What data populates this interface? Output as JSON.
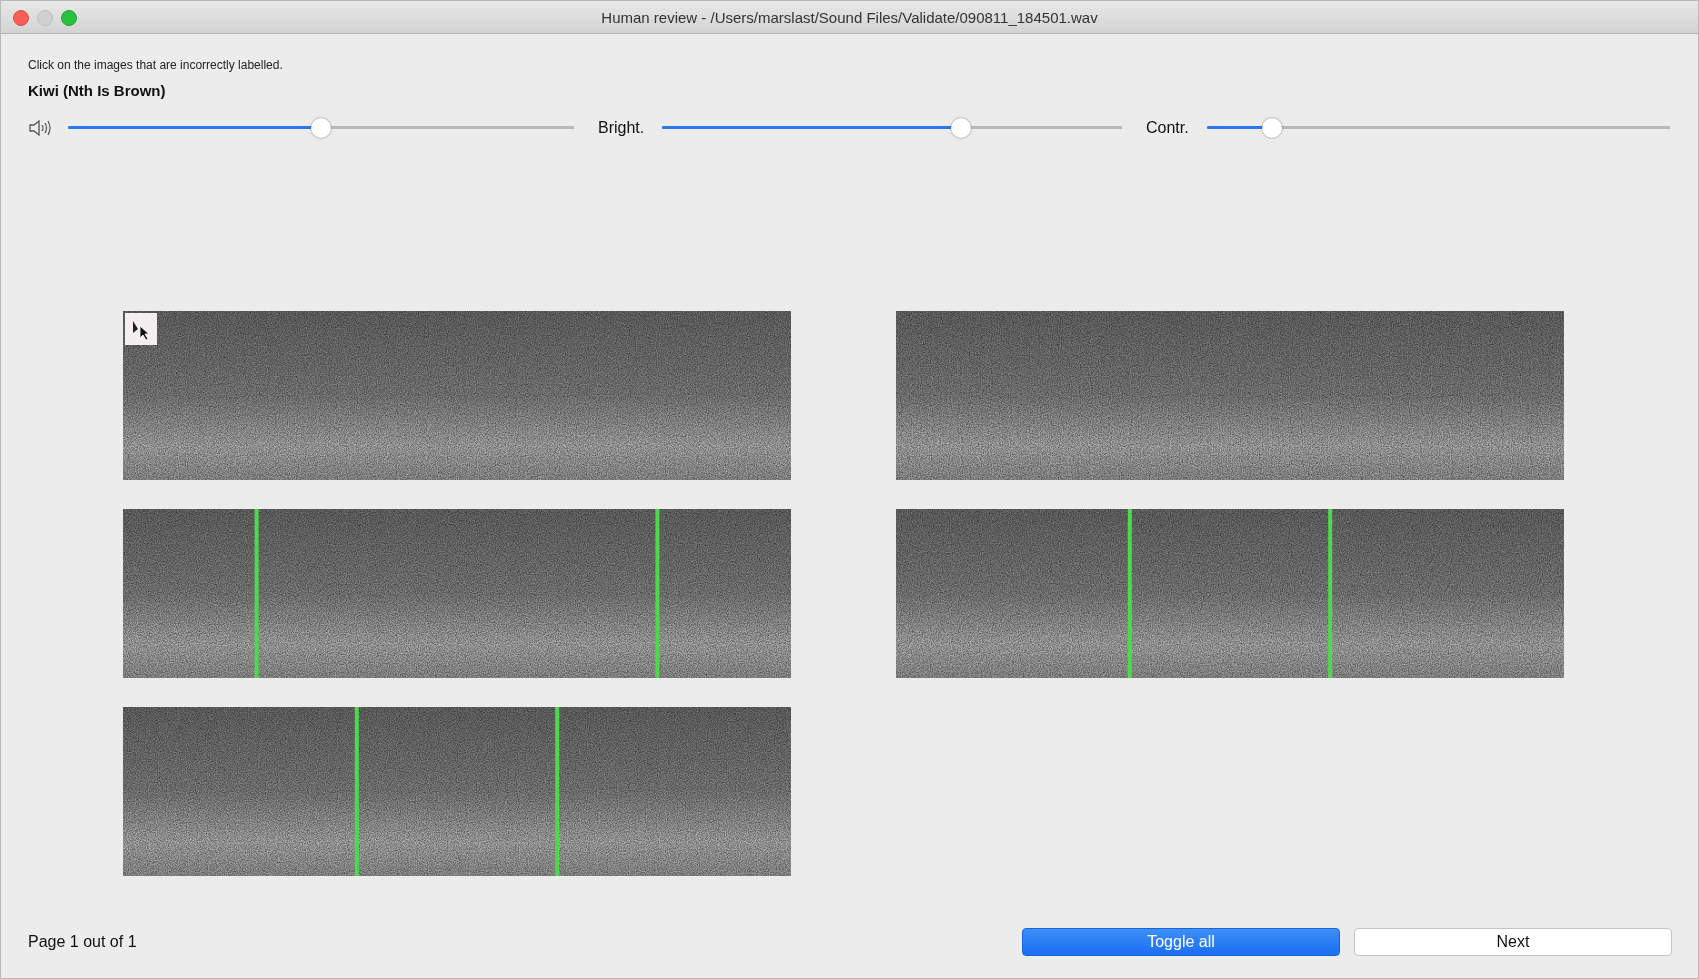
{
  "window": {
    "title": "Human review - /Users/marslast/Sound Files/Validate/090811_184501.wav"
  },
  "instruction": "Click on the images that are incorrectly labelled.",
  "species": "Kiwi (Nth Is Brown)",
  "sliders": [
    {
      "kind": "volume",
      "level": 0.5
    },
    {
      "kind": "labelled",
      "label": "Bright.",
      "level": 0.65
    },
    {
      "kind": "labelled",
      "label": "Contr.",
      "level": 0.14
    }
  ],
  "spectrograms": [
    {
      "kind": "play"
    },
    {
      "kind": "plain"
    },
    {
      "kind": "wide-markers"
    },
    {
      "kind": "narrow-markers"
    },
    {
      "kind": "narrow-markers"
    }
  ],
  "page_label": "Page 1 out of 1",
  "buttons": [
    {
      "label": "Toggle all",
      "kind": "primary"
    },
    {
      "label": "Next",
      "kind": "default"
    }
  ]
}
